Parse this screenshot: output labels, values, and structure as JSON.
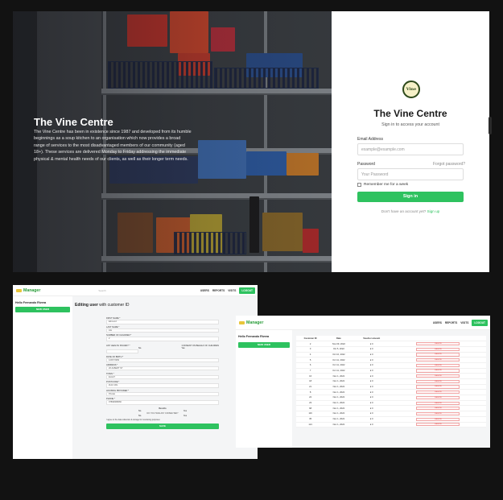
{
  "login_page": {
    "hero": {
      "title": "The Vine Centre",
      "description": "The Vine Centre has been in existence since 1987 and developed from its humble beginnings as a soup kitchen to an organisation which now provides a broad range of services to the most disadvantaged members of our community (aged 18+). These services are delivered Monday to Friday addressing the immediate physical & mental health needs of our clients, as well as their longer term needs."
    },
    "logo_text": "Vine",
    "title": "The Vine Centre",
    "subtitle": "Sign in to access your account",
    "email_label": "Email Address",
    "email_placeholder": "example@example.com",
    "password_label": "Password",
    "forgot_password": "Forgot password?",
    "password_placeholder": "Your Password",
    "remember_label": "Remember me for a week",
    "signin_label": "Sign in",
    "no_account_text": "Don't have an account yet?",
    "signup_link": "Sign up"
  },
  "admin": {
    "brand": "Manager",
    "search_placeholder": "Search",
    "nav": [
      "USERS",
      "REPORTS",
      "VISITS"
    ],
    "logout": "LOGOUT",
    "hello": "Hello Fernando Rivera",
    "new_user": "NEW USER"
  },
  "edit_form": {
    "heading_bold": "Editing user",
    "heading_rest": "with customer ID",
    "fields": [
      {
        "label": "FIRST NAME *",
        "value": "Edmund"
      },
      {
        "label": "LAST NAME *",
        "value": "Lile"
      },
      {
        "label": "NUMBER OF CHILDREN *",
        "value": "2"
      },
      {
        "label": "ANY HEALTH ISSUES? *",
        "value": ""
      },
      {
        "label": "DATE OF BIRTH *",
        "value": "12/07/1969"
      },
      {
        "label": "ADDRESS *",
        "value": "20 ALBERT ST"
      },
      {
        "label": "TOWN *",
        "value": "ELLET"
      },
      {
        "label": "POSTCODE *",
        "value": "ZL10 1RL"
      },
      {
        "label": "HOUSING PROVIDER *",
        "value": "Private"
      },
      {
        "label": "PHONE *",
        "value": "07893968066"
      }
    ],
    "consent_label": "CONSENT ON BEHALF OF CHILDREN",
    "no_label": "No",
    "yes_label": "Yes",
    "benefits_label": "Benefits",
    "stat_label": "DO YOU HAVE ANY CONNECTED?",
    "agree_label": "I agree to the data collection & storage for monitoring purposes",
    "save_label": "SAVE"
  },
  "customers_table": {
    "headers": [
      "Customer ID",
      "Date",
      "Voucher amount",
      ""
    ],
    "rows": [
      [
        "2",
        "Nov 09, 2022",
        "£ 0"
      ],
      [
        "3",
        "Oct 5, 2022",
        "£ 0"
      ],
      [
        "4",
        "Oct 10, 2022",
        "£ 0"
      ],
      [
        "5",
        "Oct 11, 2022",
        "£ 0"
      ],
      [
        "6",
        "Oct 11, 2022",
        "£ 0"
      ],
      [
        "7",
        "Oct 11, 2022",
        "£ 0"
      ],
      [
        "16",
        "Nov 1, 2022",
        "£ 0"
      ],
      [
        "18",
        "Nov 1, 2022",
        "£ 0"
      ],
      [
        "21",
        "Nov 1, 2022",
        "£ 0"
      ],
      [
        "8",
        "Nov 1, 2022",
        "£ 0"
      ],
      [
        "22",
        "Nov 1, 2022",
        "£ 0"
      ],
      [
        "23",
        "Nov 1, 2022",
        "£ 0"
      ],
      [
        "68",
        "Nov 1, 2022",
        "£ 0"
      ],
      [
        "116",
        "Nov 1, 2022",
        "£ 0"
      ],
      [
        "35",
        "Nov 1, 2022",
        "£ 0"
      ],
      [
        "121",
        "Nov 1, 2022",
        "£ 0"
      ]
    ],
    "delete_label": "DELETE"
  }
}
